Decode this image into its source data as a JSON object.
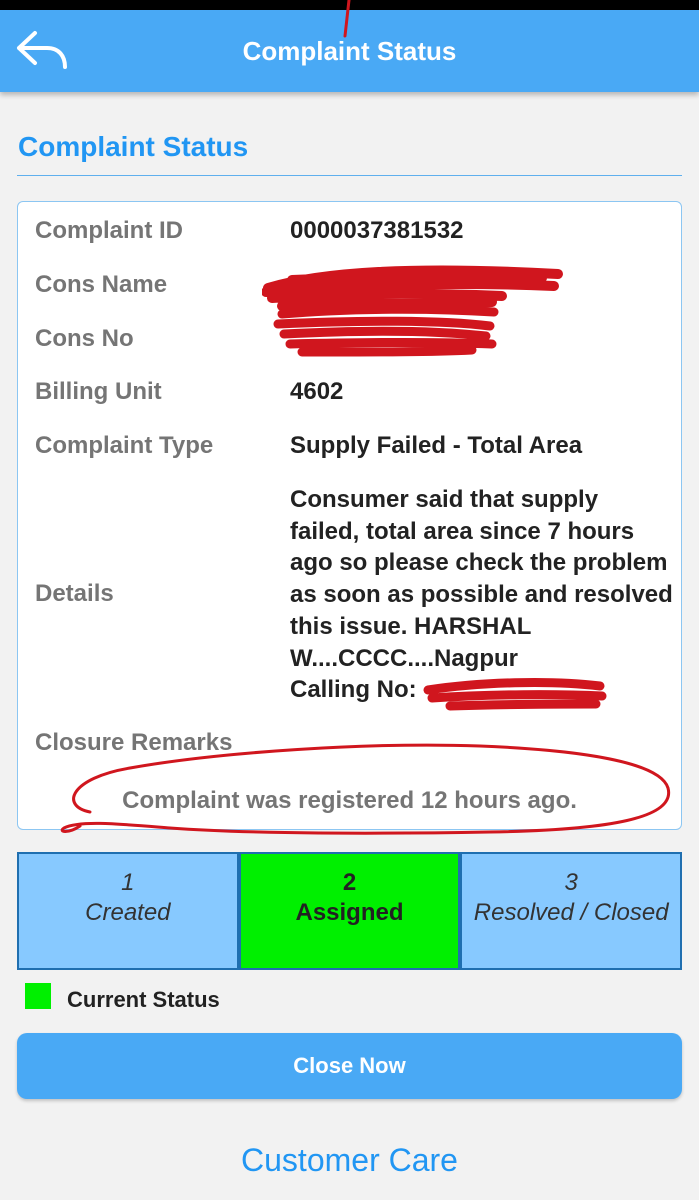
{
  "app_bar": {
    "title": "Complaint Status"
  },
  "section": {
    "title": "Complaint Status"
  },
  "details": {
    "rows": [
      {
        "label": "Complaint ID",
        "value": "0000037381532"
      },
      {
        "label": "Cons Name",
        "value": ""
      },
      {
        "label": "Cons No",
        "value": ""
      },
      {
        "label": "Billing Unit",
        "value": "4602"
      },
      {
        "label": "Complaint Type",
        "value": "Supply Failed - Total Area"
      }
    ],
    "details_label": "Details",
    "details_text": "Consumer said that supply failed, total area since 7 hours ago so please check the problem as soon as possible and resolved this issue. HARSHAL W....CCCC....Nagpur\nCalling No:",
    "closure_label": "Closure Remarks",
    "age_text": "Complaint was registered 12 hours ago."
  },
  "stepper": {
    "steps": [
      {
        "number": "1",
        "label": "Created",
        "active": false
      },
      {
        "number": "2",
        "label": "Assigned",
        "active": true
      },
      {
        "number": "3",
        "label": "Resolved / Closed",
        "active": false
      }
    ]
  },
  "legend": {
    "label": "Current Status",
    "color": "#00f000"
  },
  "actions": {
    "close_label": "Close Now"
  },
  "footer": {
    "care_label": "Customer Care"
  },
  "icons": {
    "back": "back-arrow-icon"
  },
  "colors": {
    "accent": "#49a9f5",
    "title": "#2196f3",
    "active_step": "#00f000",
    "inactive_step": "#87c9ff",
    "annotation": "#d0161e"
  }
}
